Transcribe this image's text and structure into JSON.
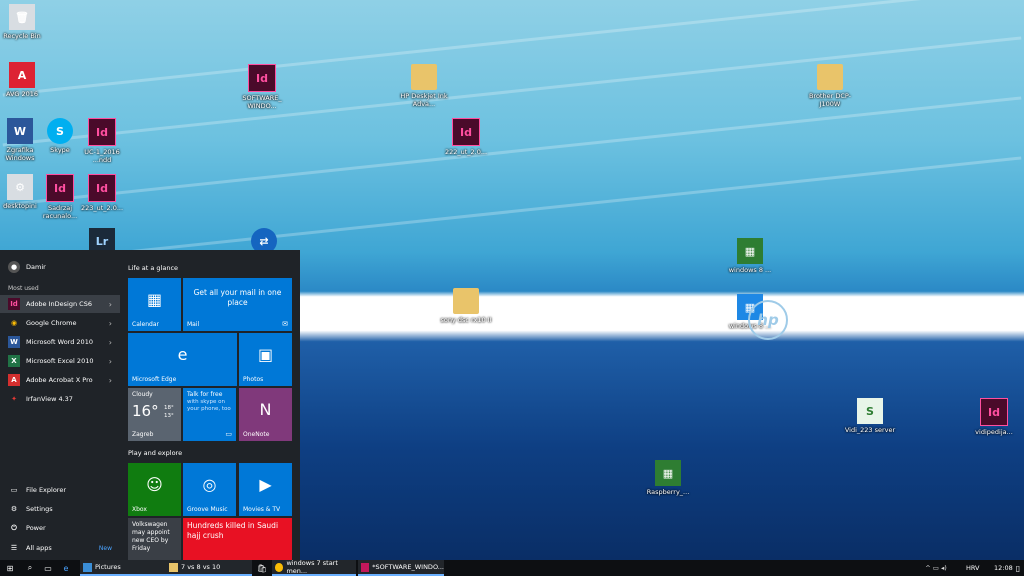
{
  "desktop": {
    "icons": [
      {
        "label": "Recycle Bin",
        "type": "plain",
        "glyph": "🗑"
      },
      {
        "label": "AVG 2016",
        "type": "plain",
        "glyph": "A"
      },
      {
        "label": "SOFTWARE_ WINDO...",
        "type": "id",
        "glyph": "Id"
      },
      {
        "label": "HP Deskjet Ink Adva...",
        "type": "folder",
        "glyph": ""
      },
      {
        "label": "Brother DCP-J100W",
        "type": "folder",
        "glyph": ""
      },
      {
        "label": "Zgrafika Windows",
        "type": "plain",
        "glyph": "W"
      },
      {
        "label": "Skype",
        "type": "plain",
        "glyph": "S"
      },
      {
        "label": "UC-1_2016 ...ndd",
        "type": "id",
        "glyph": "Id"
      },
      {
        "label": "222_ut_2.0...",
        "type": "id",
        "glyph": "Id"
      },
      {
        "label": "desktopini",
        "type": "plain",
        "glyph": "⚙"
      },
      {
        "label": "Sadrzaj racunalo...",
        "type": "id",
        "glyph": "Id"
      },
      {
        "label": "223_ut_2.0...",
        "type": "id",
        "glyph": "Id"
      },
      {
        "label": "windows 8 ...",
        "type": "plain",
        "glyph": "▦"
      },
      {
        "label": "sony dsc rx10 II",
        "type": "folder",
        "glyph": ""
      },
      {
        "label": "windows 8 ...",
        "type": "plain",
        "glyph": "▦"
      },
      {
        "label": "Vidi_223 server",
        "type": "plain",
        "glyph": "S"
      },
      {
        "label": "vidipedija...",
        "type": "id",
        "glyph": "Id"
      },
      {
        "label": "Raspberry_...",
        "type": "plain",
        "glyph": "▦"
      }
    ],
    "hp_logo": "hp"
  },
  "start_menu": {
    "user": "Damir",
    "most_used_label": "Most used",
    "apps": [
      {
        "label": "Adobe InDesign CS6",
        "glyph": "Id",
        "color": "#c2185b"
      },
      {
        "label": "Google Chrome",
        "glyph": "◉",
        "color": "#fbbc05"
      },
      {
        "label": "Microsoft Word 2010",
        "glyph": "W",
        "color": "#2b579a"
      },
      {
        "label": "Microsoft Excel 2010",
        "glyph": "X",
        "color": "#217346"
      },
      {
        "label": "Adobe Acrobat X Pro",
        "glyph": "A",
        "color": "#d32f2f"
      },
      {
        "label": "IrfanView 4.37",
        "glyph": "✦",
        "color": "#c62828"
      }
    ],
    "bottom": [
      {
        "label": "File Explorer",
        "glyph": "▭"
      },
      {
        "label": "Settings",
        "glyph": "⚙"
      },
      {
        "label": "Power",
        "glyph": "⏻"
      },
      {
        "label": "All apps",
        "glyph": "☰",
        "badge": "New"
      }
    ],
    "group1": "Life at a glance",
    "group2": "Play and explore",
    "tiles": {
      "calendar": "Calendar",
      "mail_text": "Get all your mail in one place",
      "mail": "Mail",
      "edge": "Microsoft Edge",
      "photos": "Photos",
      "weather_cond": "Cloudy",
      "weather_temp": "16°",
      "weather_hi": "18°",
      "weather_lo": "13°",
      "weather_city": "Zagreb",
      "skype_title": "Talk for free",
      "skype_text": "with skype on your phone, too",
      "onenote": "OneNote",
      "xbox": "Xbox",
      "groove": "Groove Music",
      "movies": "Movies & TV",
      "news1": "Volkswagen may appoint new CEO by Friday",
      "news2": "Hundreds killed in Saudi hajj crush"
    }
  },
  "taskbar": {
    "apps": [
      {
        "label": "Pictures",
        "color": "#3b8fd9"
      },
      {
        "label": "7 vs 8 vs 10",
        "color": "#e9c46a"
      },
      {
        "label": "windows 7 start men...",
        "color": "#fbbc05"
      },
      {
        "label": "*SOFTWARE_WINDO...",
        "color": "#c2185b"
      }
    ],
    "lang": "HRV",
    "time": "12:08",
    "tray": "^ ▭ ◂)"
  },
  "colors": {
    "accent": "#0078d7",
    "start_bg": "#1f2328",
    "taskbar_bg": "#0d0f12"
  }
}
